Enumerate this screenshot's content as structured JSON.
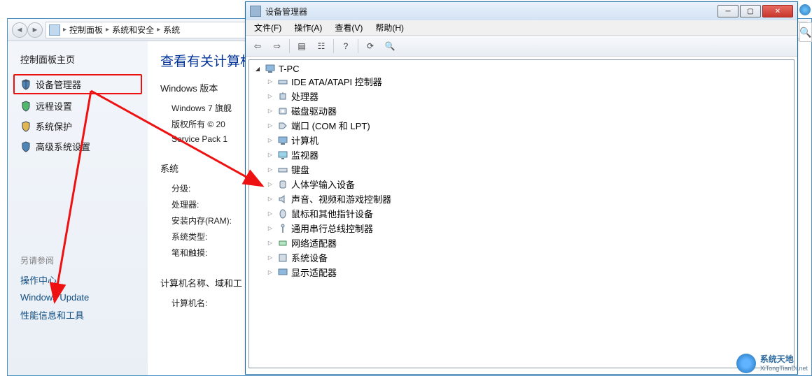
{
  "control_panel": {
    "breadcrumb": {
      "root": "控制面板",
      "level1": "系统和安全",
      "level2": "系统"
    },
    "sidebar": {
      "home": "控制面板主页",
      "items": [
        {
          "label": "设备管理器",
          "highlighted": true
        },
        {
          "label": "远程设置"
        },
        {
          "label": "系统保护"
        },
        {
          "label": "高级系统设置"
        }
      ],
      "see_also_label": "另请参阅",
      "see_also_links": [
        {
          "label": "操作中心"
        },
        {
          "label": "Windows Update"
        },
        {
          "label": "性能信息和工具"
        }
      ]
    },
    "main": {
      "heading": "查看有关计算机",
      "version_section": "Windows 版本",
      "version_line1": "Windows 7 旗舰",
      "copyright": "版权所有 © 20",
      "sp": "Service Pack 1",
      "system_section": "系统",
      "rating_label": "分级:",
      "processor_label": "处理器:",
      "ram_label": "安装内存(RAM):",
      "system_type_label": "系统类型:",
      "pen_touch_label": "笔和触摸:",
      "name_section": "计算机名称、域和工",
      "computer_name_label": "计算机名:"
    }
  },
  "device_manager": {
    "title": "设备管理器",
    "menu": {
      "file": "文件(F)",
      "action": "操作(A)",
      "view": "查看(V)",
      "help": "帮助(H)"
    },
    "root_node": "T-PC",
    "nodes": [
      {
        "label": "IDE ATA/ATAPI 控制器",
        "icon": "ide"
      },
      {
        "label": "处理器",
        "icon": "cpu"
      },
      {
        "label": "磁盘驱动器",
        "icon": "disk"
      },
      {
        "label": "端口 (COM 和 LPT)",
        "icon": "port"
      },
      {
        "label": "计算机",
        "icon": "computer"
      },
      {
        "label": "监视器",
        "icon": "monitor"
      },
      {
        "label": "键盘",
        "icon": "keyboard"
      },
      {
        "label": "人体学输入设备",
        "icon": "hid"
      },
      {
        "label": "声音、视频和游戏控制器",
        "icon": "sound"
      },
      {
        "label": "鼠标和其他指针设备",
        "icon": "mouse"
      },
      {
        "label": "通用串行总线控制器",
        "icon": "usb"
      },
      {
        "label": "网络适配器",
        "icon": "network"
      },
      {
        "label": "系统设备",
        "icon": "system"
      },
      {
        "label": "显示适配器",
        "icon": "display"
      }
    ]
  },
  "watermark": {
    "title": "系统天地",
    "sub": "XiTongTianDi.net"
  }
}
